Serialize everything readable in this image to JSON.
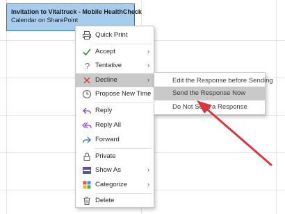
{
  "appointment": {
    "title": "Invitation to Vitaltruck - Mobile HealthCheck",
    "subtitle": "Calendar on SharePoint"
  },
  "context_menu": {
    "items": [
      {
        "label": "Quick Print",
        "icon": "printer-icon",
        "has_submenu": false
      },
      {
        "label": "Accept",
        "icon": "checkmark-icon",
        "has_submenu": true
      },
      {
        "label": "Tentative",
        "icon": "question-mark-icon",
        "has_submenu": true
      },
      {
        "label": "Decline",
        "icon": "x-icon",
        "has_submenu": true,
        "highlighted": true
      },
      {
        "label": "Propose New Time",
        "icon": "clock-icon",
        "has_submenu": true
      },
      {
        "label": "Reply",
        "icon": "reply-icon",
        "has_submenu": false
      },
      {
        "label": "Reply All",
        "icon": "reply-all-icon",
        "has_submenu": false
      },
      {
        "label": "Forward",
        "icon": "forward-icon",
        "has_submenu": false
      },
      {
        "label": "Private",
        "icon": "lock-icon",
        "has_submenu": false
      },
      {
        "label": "Show As",
        "icon": "show-as-icon",
        "has_submenu": true
      },
      {
        "label": "Categorize",
        "icon": "categorize-icon",
        "has_submenu": true
      },
      {
        "label": "Delete",
        "icon": "trash-icon",
        "has_submenu": false
      }
    ]
  },
  "decline_submenu": {
    "items": [
      {
        "label": "Edit the Response before Sending"
      },
      {
        "label": "Send the Response Now",
        "highlighted": true
      },
      {
        "label": "Do Not Send a Response"
      }
    ]
  },
  "colors": {
    "appointment_fill": "#a8cdec",
    "appointment_border": "#2f6fad",
    "highlight": "#c9c9c9",
    "annotation_arrow": "#d9363e"
  }
}
